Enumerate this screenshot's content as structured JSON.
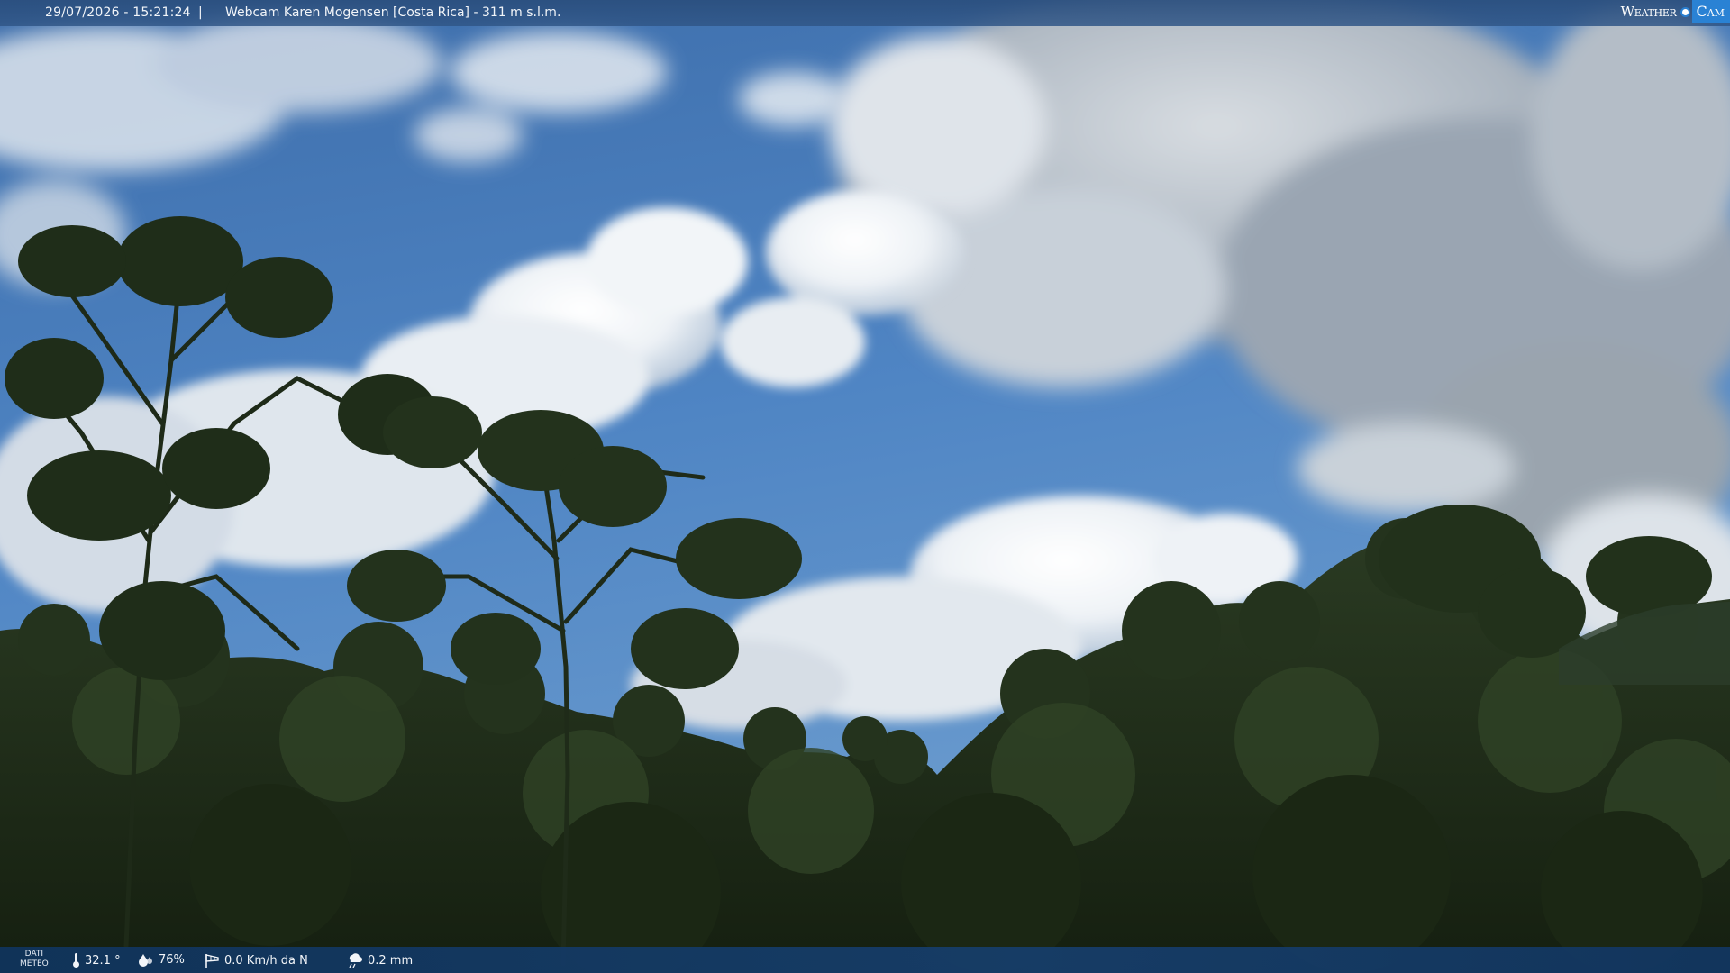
{
  "header": {
    "timestamp": "29/07/2026 - 15:21:24",
    "separator": "|",
    "location": "Webcam Karen Mogensen [Costa Rica]  - 311 m s.l.m."
  },
  "logo": {
    "word": "Weather",
    "cam": "Cam"
  },
  "footer": {
    "dati_line1": "DATI",
    "dati_line2": "METEO",
    "temperature": "32.1 °",
    "humidity": "76%",
    "wind": "0.0 Km/h da N",
    "rain": "0.2 mm"
  },
  "icons": {
    "temperature": "thermometer-icon",
    "humidity": "humidity-drop-icon",
    "wind": "windsock-icon",
    "rain": "rain-cloud-icon"
  },
  "colors": {
    "sky": "#3a6fb0",
    "bar": "#2a4e7d",
    "accent": "#2a82d4",
    "forest": "#1c2a16"
  }
}
